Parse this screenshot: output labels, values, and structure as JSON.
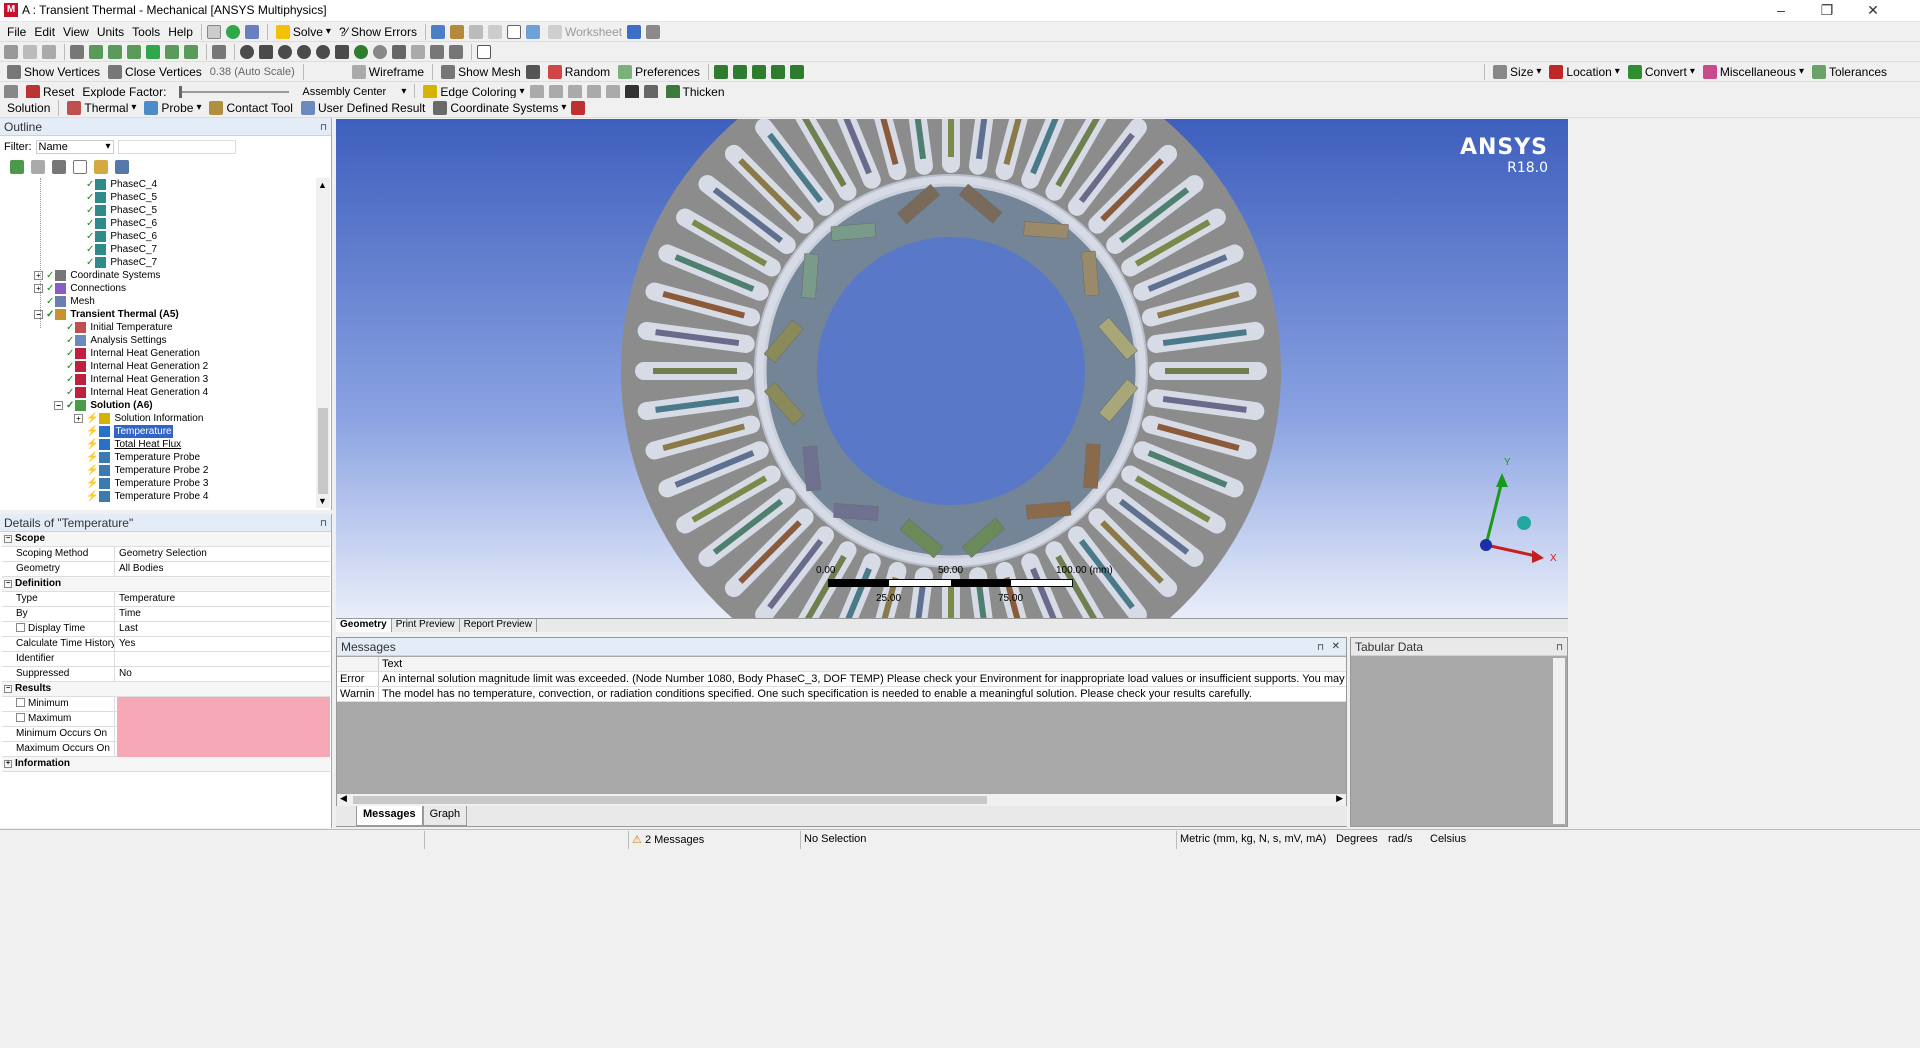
{
  "window": {
    "title": "A : Transient Thermal - Mechanical [ANSYS Multiphysics]",
    "logo_letter": "M",
    "controls": [
      "–",
      "❐",
      "✕"
    ]
  },
  "menubar": {
    "items": [
      "File",
      "Edit",
      "View",
      "Units",
      "Tools",
      "Help"
    ],
    "solve": "Solve",
    "show_errors": "?⁄ Show Errors",
    "worksheet": "Worksheet"
  },
  "toolbar3": {
    "show_vertices": "Show Vertices",
    "close_vertices": "Close Vertices",
    "auto_scale": "0.38 (Auto Scale)",
    "wireframe": "Wireframe",
    "show_mesh": "Show Mesh",
    "random": "Random",
    "preferences": "Preferences",
    "size": "Size",
    "location": "Location",
    "convert": "Convert",
    "miscellaneous": "Miscellaneous",
    "tolerances": "Tolerances"
  },
  "toolbar4": {
    "reset": "Reset",
    "explode_factor": "Explode Factor:",
    "assembly_center": "Assembly Center",
    "edge_coloring": "Edge Coloring",
    "thicken": "Thicken"
  },
  "toolbar5": {
    "solution": "Solution",
    "thermal": "Thermal",
    "probe": "Probe",
    "contact_tool": "Contact Tool",
    "user_defined_result": "User Defined Result",
    "coordinate_systems": "Coordinate Systems"
  },
  "outline": {
    "title": "Outline",
    "filter_label": "Filter:",
    "filter_value": "Name",
    "tree": [
      {
        "label": "PhaseC_4",
        "indent": 3,
        "type": "body"
      },
      {
        "label": "PhaseC_5",
        "indent": 3,
        "type": "body"
      },
      {
        "label": "PhaseC_5",
        "indent": 3,
        "type": "body"
      },
      {
        "label": "PhaseC_6",
        "indent": 3,
        "type": "body"
      },
      {
        "label": "PhaseC_6",
        "indent": 3,
        "type": "body"
      },
      {
        "label": "PhaseC_7",
        "indent": 3,
        "type": "body"
      },
      {
        "label": "PhaseC_7",
        "indent": 3,
        "type": "body"
      },
      {
        "label": "Coordinate Systems",
        "indent": 1,
        "type": "coords",
        "expander": "+"
      },
      {
        "label": "Connections",
        "indent": 1,
        "type": "conn",
        "expander": "+"
      },
      {
        "label": "Mesh",
        "indent": 1,
        "type": "mesh"
      },
      {
        "label": "Transient Thermal (A5)",
        "indent": 1,
        "type": "analysis",
        "expander": "−",
        "bold": true
      },
      {
        "label": "Initial Temperature",
        "indent": 2,
        "type": "init"
      },
      {
        "label": "Analysis Settings",
        "indent": 2,
        "type": "settings"
      },
      {
        "label": "Internal Heat Generation",
        "indent": 2,
        "type": "heat"
      },
      {
        "label": "Internal Heat Generation 2",
        "indent": 2,
        "type": "heat"
      },
      {
        "label": "Internal Heat Generation 3",
        "indent": 2,
        "type": "heat"
      },
      {
        "label": "Internal Heat Generation 4",
        "indent": 2,
        "type": "heat"
      },
      {
        "label": "Solution (A6)",
        "indent": 2,
        "type": "solution",
        "expander": "−",
        "bold": true
      },
      {
        "label": "Solution Information",
        "indent": 3,
        "type": "info",
        "expander": "+"
      },
      {
        "label": "Temperature",
        "indent": 3,
        "type": "result",
        "selected": true
      },
      {
        "label": "Total Heat Flux",
        "indent": 3,
        "type": "result",
        "underline": true
      },
      {
        "label": "Temperature Probe",
        "indent": 3,
        "type": "probe"
      },
      {
        "label": "Temperature Probe 2",
        "indent": 3,
        "type": "probe"
      },
      {
        "label": "Temperature Probe 3",
        "indent": 3,
        "type": "probe"
      },
      {
        "label": "Temperature Probe 4",
        "indent": 3,
        "type": "probe"
      }
    ]
  },
  "details": {
    "title": "Details of \"Temperature\"",
    "rows": [
      {
        "group": "Scope"
      },
      {
        "key": "Scoping Method",
        "value": "Geometry Selection"
      },
      {
        "key": "Geometry",
        "value": "All Bodies"
      },
      {
        "group": "Definition"
      },
      {
        "key": "Type",
        "value": "Temperature"
      },
      {
        "key": "By",
        "value": "Time"
      },
      {
        "key": "Display Time",
        "value": "Last",
        "checkbox": true
      },
      {
        "key": "Calculate Time History",
        "value": "Yes"
      },
      {
        "key": "Identifier",
        "value": ""
      },
      {
        "key": "Suppressed",
        "value": "No"
      },
      {
        "group": "Results"
      },
      {
        "key": "Minimum",
        "value": "",
        "checkbox": true,
        "pink": true
      },
      {
        "key": "Maximum",
        "value": "",
        "checkbox": true,
        "pink": true
      },
      {
        "key": "Minimum Occurs On",
        "value": "",
        "pink": true
      },
      {
        "key": "Maximum Occurs On",
        "value": "",
        "pink": true
      },
      {
        "group": "Information",
        "collapsed": true
      }
    ]
  },
  "viewport": {
    "brand": "ANSYS",
    "version": "R18.0",
    "scale_labels_top": [
      "0.00",
      "50.00",
      "100.00 (mm)"
    ],
    "scale_labels_bottom": [
      "25.00",
      "75.00"
    ],
    "axis_y": "Y",
    "axis_x": "X",
    "colors": {
      "stator": "#8c8c8c",
      "slot": "#d7dbe6",
      "rotor": "#738597",
      "bore": "#5a78c8"
    }
  },
  "geo_tabs": [
    "Geometry",
    "Print Preview",
    "Report Preview"
  ],
  "messages": {
    "title": "Messages",
    "header": "Text",
    "rows": [
      {
        "severity": "Error",
        "text": "An internal solution magnitude limit was exceeded. (Node Number 1080, Body PhaseC_3, DOF TEMP) Please check your Environment for inappropriate load values or insufficient supports.  You may select"
      },
      {
        "severity": "Warnin",
        "text": "The model has no temperature, convection, or radiation conditions specified. One such specification is needed to enable a meaningful solution.  Please check your results carefully."
      }
    ],
    "tabs": [
      "Messages",
      "Graph"
    ]
  },
  "tabular": {
    "title": "Tabular Data"
  },
  "statusbar": {
    "messages": "2 Messages",
    "selection": "No Selection",
    "units": "Metric (mm, kg, N, s, mV, mA)",
    "degrees": "Degrees",
    "rad": "rad/s",
    "celsius": "Celsius"
  }
}
